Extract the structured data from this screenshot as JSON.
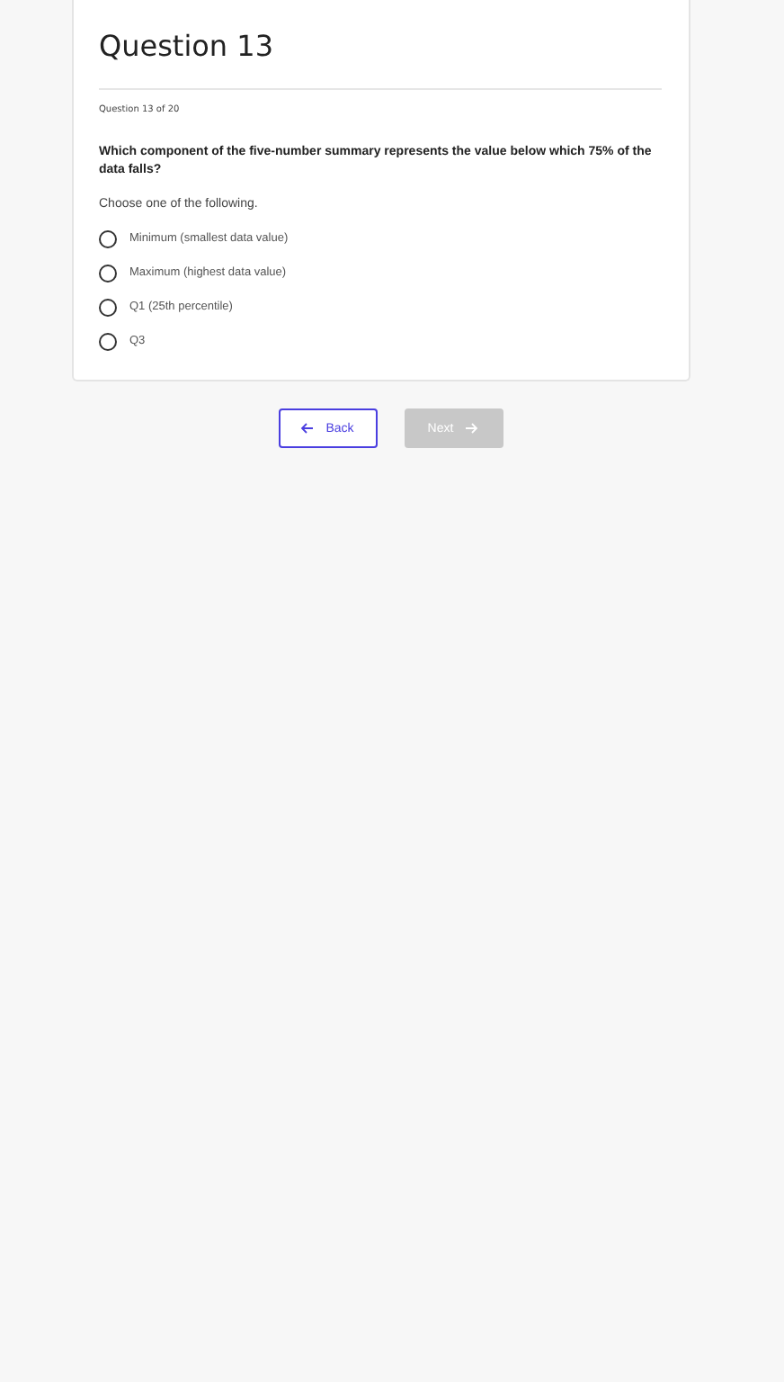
{
  "title": "Question 13",
  "progress": "Question 13 of 20",
  "question": "Which component of the five-number summary represents the value below which 75% of the data falls?",
  "instruction": "Choose one of the following.",
  "options": [
    {
      "label": "Minimum (smallest data value)",
      "selected": false
    },
    {
      "label": "Maximum (highest data value)",
      "selected": false
    },
    {
      "label": "Q1 (25th percentile)",
      "selected": false
    },
    {
      "label": "Q3",
      "selected": false
    }
  ],
  "buttons": [
    {
      "kind": "back",
      "label": "Back",
      "disabled": false
    },
    {
      "kind": "next",
      "label": "Next",
      "disabled": true
    }
  ]
}
